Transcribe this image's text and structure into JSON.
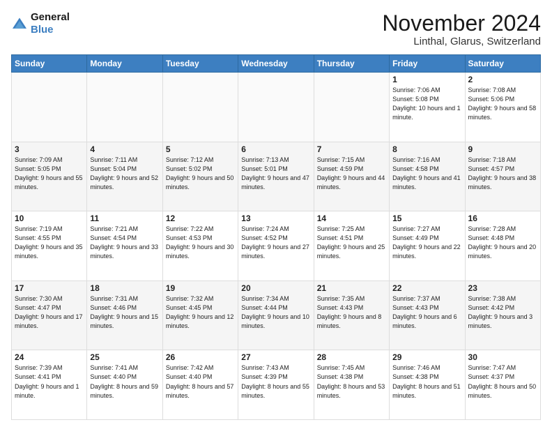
{
  "logo": {
    "line1": "General",
    "line2": "Blue"
  },
  "title": "November 2024",
  "subtitle": "Linthal, Glarus, Switzerland",
  "days_header": [
    "Sunday",
    "Monday",
    "Tuesday",
    "Wednesday",
    "Thursday",
    "Friday",
    "Saturday"
  ],
  "weeks": [
    [
      {
        "day": "",
        "detail": ""
      },
      {
        "day": "",
        "detail": ""
      },
      {
        "day": "",
        "detail": ""
      },
      {
        "day": "",
        "detail": ""
      },
      {
        "day": "",
        "detail": ""
      },
      {
        "day": "1",
        "detail": "Sunrise: 7:06 AM\nSunset: 5:08 PM\nDaylight: 10 hours\nand 1 minute."
      },
      {
        "day": "2",
        "detail": "Sunrise: 7:08 AM\nSunset: 5:06 PM\nDaylight: 9 hours\nand 58 minutes."
      }
    ],
    [
      {
        "day": "3",
        "detail": "Sunrise: 7:09 AM\nSunset: 5:05 PM\nDaylight: 9 hours\nand 55 minutes."
      },
      {
        "day": "4",
        "detail": "Sunrise: 7:11 AM\nSunset: 5:04 PM\nDaylight: 9 hours\nand 52 minutes."
      },
      {
        "day": "5",
        "detail": "Sunrise: 7:12 AM\nSunset: 5:02 PM\nDaylight: 9 hours\nand 50 minutes."
      },
      {
        "day": "6",
        "detail": "Sunrise: 7:13 AM\nSunset: 5:01 PM\nDaylight: 9 hours\nand 47 minutes."
      },
      {
        "day": "7",
        "detail": "Sunrise: 7:15 AM\nSunset: 4:59 PM\nDaylight: 9 hours\nand 44 minutes."
      },
      {
        "day": "8",
        "detail": "Sunrise: 7:16 AM\nSunset: 4:58 PM\nDaylight: 9 hours\nand 41 minutes."
      },
      {
        "day": "9",
        "detail": "Sunrise: 7:18 AM\nSunset: 4:57 PM\nDaylight: 9 hours\nand 38 minutes."
      }
    ],
    [
      {
        "day": "10",
        "detail": "Sunrise: 7:19 AM\nSunset: 4:55 PM\nDaylight: 9 hours\nand 35 minutes."
      },
      {
        "day": "11",
        "detail": "Sunrise: 7:21 AM\nSunset: 4:54 PM\nDaylight: 9 hours\nand 33 minutes."
      },
      {
        "day": "12",
        "detail": "Sunrise: 7:22 AM\nSunset: 4:53 PM\nDaylight: 9 hours\nand 30 minutes."
      },
      {
        "day": "13",
        "detail": "Sunrise: 7:24 AM\nSunset: 4:52 PM\nDaylight: 9 hours\nand 27 minutes."
      },
      {
        "day": "14",
        "detail": "Sunrise: 7:25 AM\nSunset: 4:51 PM\nDaylight: 9 hours\nand 25 minutes."
      },
      {
        "day": "15",
        "detail": "Sunrise: 7:27 AM\nSunset: 4:49 PM\nDaylight: 9 hours\nand 22 minutes."
      },
      {
        "day": "16",
        "detail": "Sunrise: 7:28 AM\nSunset: 4:48 PM\nDaylight: 9 hours\nand 20 minutes."
      }
    ],
    [
      {
        "day": "17",
        "detail": "Sunrise: 7:30 AM\nSunset: 4:47 PM\nDaylight: 9 hours\nand 17 minutes."
      },
      {
        "day": "18",
        "detail": "Sunrise: 7:31 AM\nSunset: 4:46 PM\nDaylight: 9 hours\nand 15 minutes."
      },
      {
        "day": "19",
        "detail": "Sunrise: 7:32 AM\nSunset: 4:45 PM\nDaylight: 9 hours\nand 12 minutes."
      },
      {
        "day": "20",
        "detail": "Sunrise: 7:34 AM\nSunset: 4:44 PM\nDaylight: 9 hours\nand 10 minutes."
      },
      {
        "day": "21",
        "detail": "Sunrise: 7:35 AM\nSunset: 4:43 PM\nDaylight: 9 hours\nand 8 minutes."
      },
      {
        "day": "22",
        "detail": "Sunrise: 7:37 AM\nSunset: 4:43 PM\nDaylight: 9 hours\nand 6 minutes."
      },
      {
        "day": "23",
        "detail": "Sunrise: 7:38 AM\nSunset: 4:42 PM\nDaylight: 9 hours\nand 3 minutes."
      }
    ],
    [
      {
        "day": "24",
        "detail": "Sunrise: 7:39 AM\nSunset: 4:41 PM\nDaylight: 9 hours\nand 1 minute."
      },
      {
        "day": "25",
        "detail": "Sunrise: 7:41 AM\nSunset: 4:40 PM\nDaylight: 8 hours\nand 59 minutes."
      },
      {
        "day": "26",
        "detail": "Sunrise: 7:42 AM\nSunset: 4:40 PM\nDaylight: 8 hours\nand 57 minutes."
      },
      {
        "day": "27",
        "detail": "Sunrise: 7:43 AM\nSunset: 4:39 PM\nDaylight: 8 hours\nand 55 minutes."
      },
      {
        "day": "28",
        "detail": "Sunrise: 7:45 AM\nSunset: 4:38 PM\nDaylight: 8 hours\nand 53 minutes."
      },
      {
        "day": "29",
        "detail": "Sunrise: 7:46 AM\nSunset: 4:38 PM\nDaylight: 8 hours\nand 51 minutes."
      },
      {
        "day": "30",
        "detail": "Sunrise: 7:47 AM\nSunset: 4:37 PM\nDaylight: 8 hours\nand 50 minutes."
      }
    ]
  ]
}
